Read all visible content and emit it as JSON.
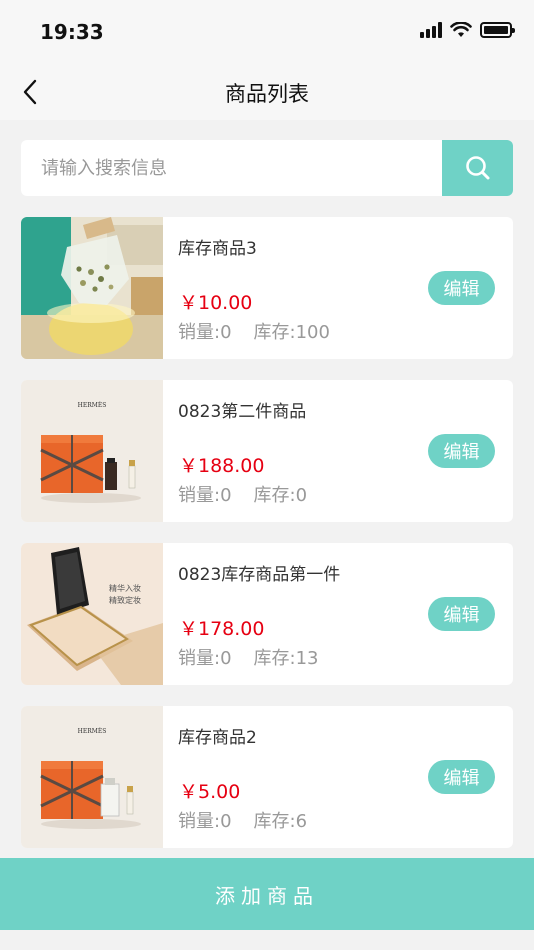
{
  "status": {
    "time": "19:33"
  },
  "nav": {
    "title": "商品列表"
  },
  "search": {
    "placeholder": "请输入搜索信息"
  },
  "products": [
    {
      "name": "库存商品3",
      "price": "￥10.00",
      "sales": "销量:0",
      "stock": "库存:100",
      "edit_label": "编辑",
      "image": "tea-bag-photo"
    },
    {
      "name": "0823第二件商品",
      "price": "￥188.00",
      "sales": "销量:0",
      "stock": "库存:0",
      "edit_label": "编辑",
      "image": "hermes-gift-box-photo"
    },
    {
      "name": "0823库存商品第一件",
      "price": "￥178.00",
      "sales": "销量:0",
      "stock": "库存:13",
      "edit_label": "编辑",
      "image": "compact-powder-photo",
      "image_text": [
        "精华入妆",
        "精致定妆"
      ]
    },
    {
      "name": "库存商品2",
      "price": "￥5.00",
      "sales": "销量:0",
      "stock": "库存:6",
      "edit_label": "编辑",
      "image": "hermes-gift-box-photo"
    }
  ],
  "brand_logo_text": "HERMÈS",
  "footer": {
    "add_label": "添加商品"
  },
  "colors": {
    "accent": "#6fd2c6",
    "price": "#e60012",
    "muted": "#999999",
    "background": "#f2f2f2"
  }
}
